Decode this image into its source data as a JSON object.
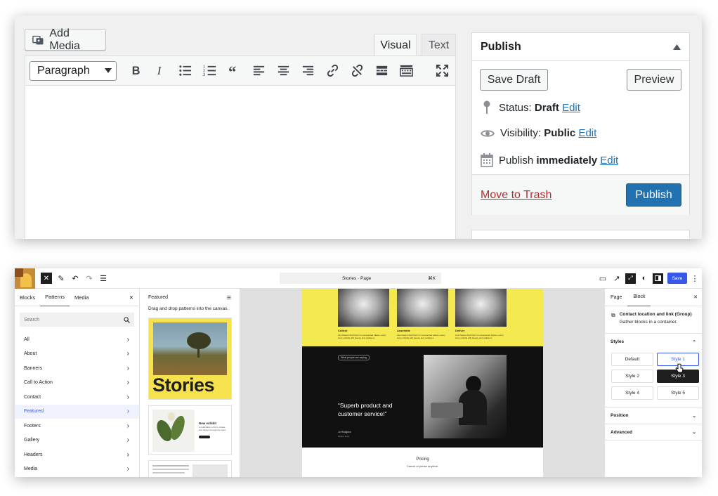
{
  "classic": {
    "add_media": "Add Media",
    "tabs": {
      "visual": "Visual",
      "text": "Text"
    },
    "format_select": "Paragraph",
    "toolbar_icons": [
      "bold-icon",
      "italic-icon",
      "bullet-list-icon",
      "numbered-list-icon",
      "blockquote-icon",
      "align-left-icon",
      "align-center-icon",
      "align-right-icon",
      "link-icon",
      "unlink-icon",
      "read-more-icon",
      "toolbar-toggle-icon",
      "fullscreen-icon"
    ],
    "publish": {
      "title": "Publish",
      "save_draft": "Save Draft",
      "preview": "Preview",
      "status_label": "Status:",
      "status_value": "Draft",
      "visibility_label": "Visibility:",
      "visibility_value": "Public",
      "publish_label": "Publish",
      "publish_value": "immediately",
      "edit": "Edit",
      "trash": "Move to Trash",
      "publish_button": "Publish"
    }
  },
  "gutenberg": {
    "doc_title": "Stories · Page",
    "shortcut": "⌘K",
    "save": "Save",
    "sidebar_tabs": [
      "Blocks",
      "Patterns",
      "Media"
    ],
    "search_placeholder": "Search",
    "categories": [
      "All",
      "About",
      "Banners",
      "Call to Action",
      "Contact",
      "Featured",
      "Footers",
      "Gallery",
      "Headers",
      "Media"
    ],
    "active_category": "Featured",
    "patterns_title": "Featured",
    "patterns_hint": "Drag and drop patterns into the canvas.",
    "pattern_stories": "Stories",
    "pattern2_title": "New exhibit",
    "pattern2_body": "A celebration of form, shape, and design through the ages.",
    "canvas": {
      "columns": [
        {
          "title": "Collect",
          "text": "Like flowers that bloom in unexpected places, every story unfolds with beauty and resilience"
        },
        {
          "title": "Assemble",
          "text": "Like flowers that bloom in unexpected places, every story unfolds with beauty and resilience"
        },
        {
          "title": "Deliver",
          "text": "Like flowers that bloom in unexpected places, every story unfolds with beauty and resilience"
        }
      ],
      "badge": "What people are saying",
      "quote": "“Superb product and customer service!”",
      "quote_author": "Jo Hodgson",
      "quote_role": "Nature lover",
      "pricing": "Pricing",
      "pricing_sub": "Cancel or pause anytime."
    },
    "right": {
      "tabs": [
        "Page",
        "Block"
      ],
      "block_name": "Contact location and link (Group)",
      "block_desc": "Gather blocks in a container.",
      "styles_label": "Styles",
      "styles": [
        "Default",
        "Style 1",
        "Style 2",
        "Style 3",
        "Style 4",
        "Style 5"
      ],
      "position_label": "Position",
      "advanced_label": "Advanced"
    }
  }
}
